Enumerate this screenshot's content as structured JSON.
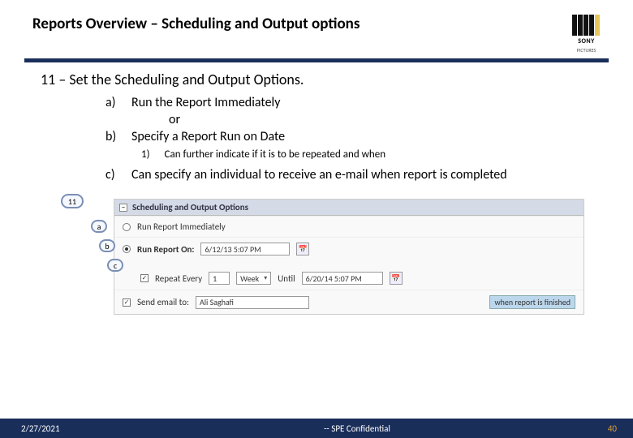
{
  "header": {
    "title": "Reports Overview – Scheduling and Output options",
    "logo_brand": "SONY",
    "logo_under": "PICTURES"
  },
  "heading": {
    "num": "11",
    "dash": "–",
    "text": "Set the Scheduling and Output Options."
  },
  "items": {
    "a_marker": "a)",
    "a_text": "Run the Report Immediately",
    "or": "or",
    "b_marker": "b)",
    "b_text": "Specify a Report Run on Date",
    "b1_marker": "1)",
    "b1_text": "Can further indicate if it is to be repeated and when",
    "c_marker": "c)",
    "c_text": "Can specify an individual to receive an e-mail when report is completed"
  },
  "figure": {
    "callout_11": "11",
    "callout_a": "a",
    "callout_b": "b",
    "callout_c": "c",
    "panel_title": "Scheduling and Output Options",
    "row_a": {
      "label": "Run Report Immediately"
    },
    "row_b": {
      "label": "Run Report On:",
      "datetime": "6/12/13 5:07 PM",
      "repeat_label": "Repeat Every",
      "repeat_num": "1",
      "repeat_unit": "Week",
      "until_label": "Until",
      "until_date": "6/20/14 5:07 PM"
    },
    "row_c": {
      "label": "Send email to:",
      "recipient": "Ali Saghafi",
      "when": "when report is finished"
    }
  },
  "footer": {
    "date": "2/27/2021",
    "center": "-- SPE Confidential",
    "page": "40"
  }
}
